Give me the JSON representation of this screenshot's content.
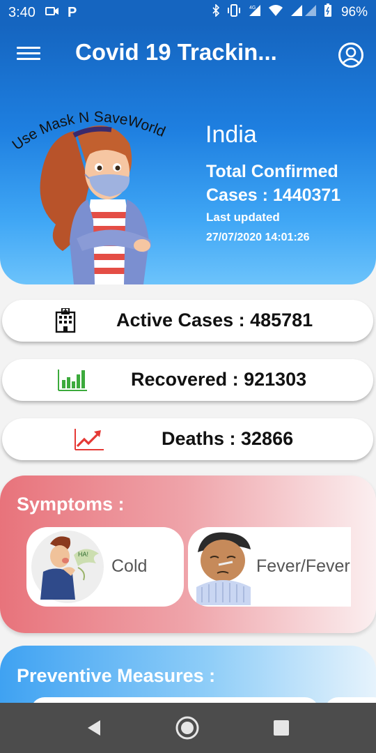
{
  "status_bar": {
    "time": "3:40",
    "battery": "96%",
    "icons": [
      "video-icon",
      "parking-icon",
      "bluetooth-icon",
      "vibrate-icon",
      "4g-icon",
      "wifi-icon",
      "signal-icon",
      "battery-icon"
    ]
  },
  "header": {
    "title": "Covid 19 Trackin...",
    "menu_icon": "hamburger-menu-icon",
    "account_icon": "account-circle-icon",
    "illustration_caption": "Use Mask N SaveWorld",
    "country": "India",
    "total_confirmed_label": "Total Confirmed",
    "cases_label": "Cases : 1440371",
    "total_confirmed": 1440371,
    "last_updated_label": "Last updated",
    "last_updated_value": "27/07/2020 14:01:26"
  },
  "stats": {
    "active_text": "Active Cases : 485781",
    "active_icon": "hospital-building-icon",
    "recovered_text": "Recovered : 921303",
    "recovered_icon": "bar-chart-icon",
    "deaths_text": "Deaths : 32866",
    "deaths_icon": "trending-up-icon"
  },
  "symptoms": {
    "title": "Symptoms :",
    "items": [
      {
        "label": "Cold",
        "image": "sneezing-man-illustration"
      },
      {
        "label": "Fever/Fever",
        "image": "fever-man-illustration"
      }
    ]
  },
  "preventive": {
    "title": "Preventive Measures :"
  },
  "colors": {
    "header_top": "#1565c0",
    "header_bottom": "#6cc3fb",
    "recovered_green": "#3caa3c",
    "deaths_red": "#e53935",
    "symptoms_pink": "#e8737b"
  },
  "navbar": {
    "icons": [
      "back-icon",
      "home-icon",
      "recents-icon"
    ]
  }
}
